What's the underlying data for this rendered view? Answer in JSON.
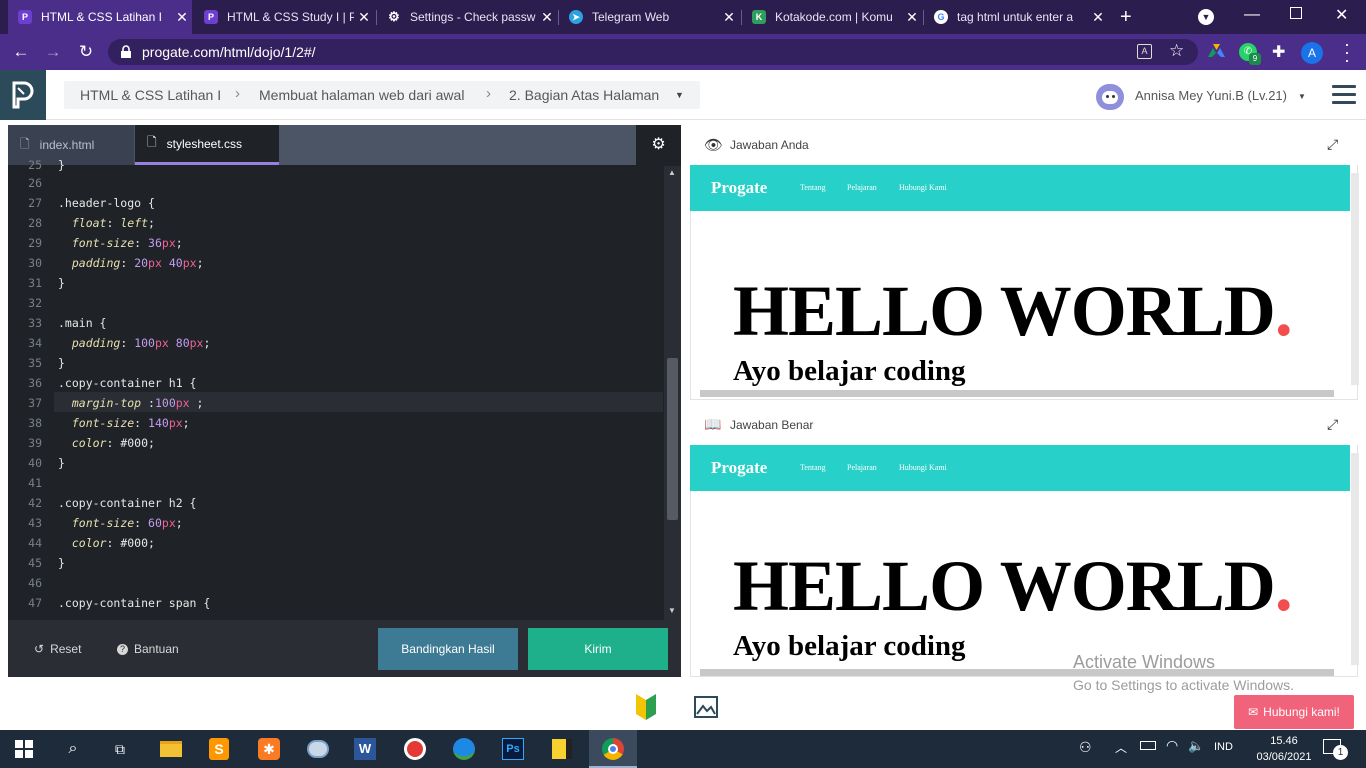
{
  "browser": {
    "tabs": [
      {
        "title": "HTML & CSS Latihan I",
        "icon": "progate-icon",
        "active": true
      },
      {
        "title": "HTML & CSS Study I | P",
        "icon": "progate-icon",
        "active": false
      },
      {
        "title": "Settings - Check passw",
        "icon": "gear-icon",
        "active": false
      },
      {
        "title": "Telegram Web",
        "icon": "telegram-icon",
        "active": false
      },
      {
        "title": "Kotakode.com | Komu",
        "icon": "kotakode-icon",
        "active": false
      },
      {
        "title": "tag html untuk enter a",
        "icon": "google-icon",
        "active": false
      }
    ],
    "url": "progate.com/html/dojo/1/2#/",
    "profile_initial": "A",
    "whatsapp_badge": "9"
  },
  "header": {
    "breadcrumb": [
      "HTML & CSS Latihan I",
      "Membuat halaman web dari awal",
      "2. Bagian Atas Halaman"
    ],
    "user": "Annisa Mey Yuni.B (Lv.21)"
  },
  "editor": {
    "tabs": [
      {
        "label": "index.html",
        "active": false
      },
      {
        "label": "stylesheet.css",
        "active": true
      }
    ],
    "footer": {
      "reset": "Reset",
      "help": "Bantuan",
      "compare": "Bandingkan Hasil",
      "submit": "Kirim"
    }
  },
  "preview": {
    "answer_title": "Jawaban Anda",
    "correct_title": "Jawaban Benar",
    "site": {
      "brand": "Progate",
      "links": [
        "Tentang",
        "Pelajaran",
        "Hubungi Kami"
      ],
      "headline": "HELLO WORLD",
      "headline_dot": ".",
      "subtitle": "Ayo belajar coding"
    }
  },
  "watermark": {
    "line1": "Activate Windows",
    "line2": "Go to Settings to activate Windows."
  },
  "contact_button": "Hubungi kami!",
  "taskbar": {
    "lang": "IND",
    "time": "15.46",
    "date": "03/06/2021",
    "notif_count": "1"
  }
}
